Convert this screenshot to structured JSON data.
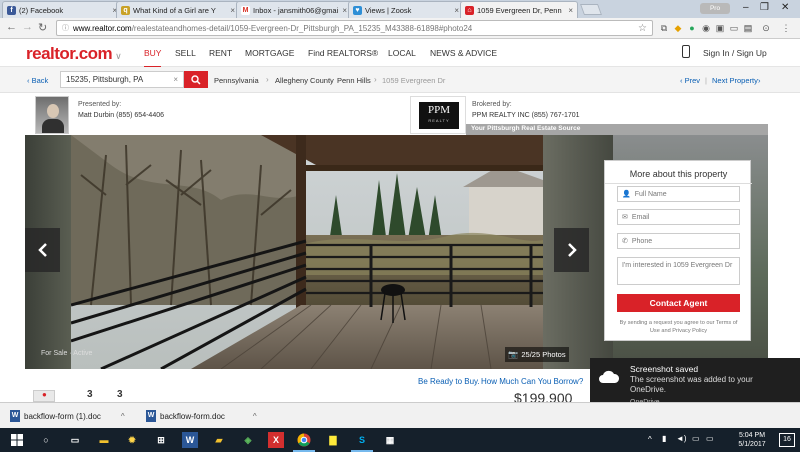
{
  "browser": {
    "tabs": [
      {
        "title": "(2) Facebook",
        "favicon": "f",
        "color": "#3b5998"
      },
      {
        "title": "What Kind of a Girl are Y",
        "favicon": "q",
        "color": "#c9a227"
      },
      {
        "title": "Inbox - jansmith06@gmai",
        "favicon": "M",
        "color": "#d93025"
      },
      {
        "title": "Views | Zoosk",
        "favicon": "♥",
        "color": "#2e8fd6"
      },
      {
        "title": "1059 Evergreen Dr, Penn",
        "favicon": "⌂",
        "color": "#d92228"
      }
    ],
    "profile_label": "Pro",
    "url_host": "www.realtor.com",
    "url_path": "/realestateandhomes-detail/1059-Evergreen-Dr_Pittsburgh_PA_15235_M43388-61898#photo24"
  },
  "site": {
    "logo": "realtor.com",
    "nav": [
      "BUY",
      "SELL",
      "RENT",
      "MORTGAGE",
      "Find REALTORS®",
      "LOCAL",
      "NEWS & ADVICE"
    ],
    "signin": "Sign In / Sign Up"
  },
  "crumbbar": {
    "back": "Back",
    "search_value": "15235, Pittsburgh, PA",
    "crumbs": [
      "Pennsylvania",
      "Allegheny County",
      "Penn Hills",
      "1059 Evergreen Dr"
    ],
    "prev": "Prev",
    "next": "Next Property"
  },
  "agent": {
    "presented_by": "Presented by:",
    "name_phone": "Matt Durbin (855) 654-4406"
  },
  "broker": {
    "logo_text": "PPM",
    "logo_sub": "REALTY",
    "brokered_by": "Brokered by:",
    "name_phone": "PPM REALTY INC (855) 767-1701",
    "tagline": "Your Pittsburgh Real Estate Source"
  },
  "gallery": {
    "status": "For Sale · Active",
    "photo_count": "25/25 Photos"
  },
  "contact": {
    "heading": "More about this property",
    "full_name_ph": "Full Name",
    "email_ph": "Email",
    "phone_ph": "Phone",
    "message": "I'm interested in 1059 Evergreen Dr",
    "button": "Contact Agent",
    "disclaimer": "By sending a request you agree to our Terms of Use and Privacy Policy"
  },
  "below": {
    "beds": "3",
    "baths": "3",
    "buy_ready": "Be Ready to Buy.",
    "how_much": "How Much Can You Borrow?",
    "price": "$199,900"
  },
  "toast": {
    "title": "Screenshot saved",
    "body": "The screenshot was added to your OneDrive.",
    "app": "OneDrive"
  },
  "downloads": [
    "backflow-form (1).doc",
    "backflow-form.doc"
  ],
  "taskbar": {
    "time": "5:04 PM",
    "date": "5/1/2017",
    "notif_count": "16"
  }
}
